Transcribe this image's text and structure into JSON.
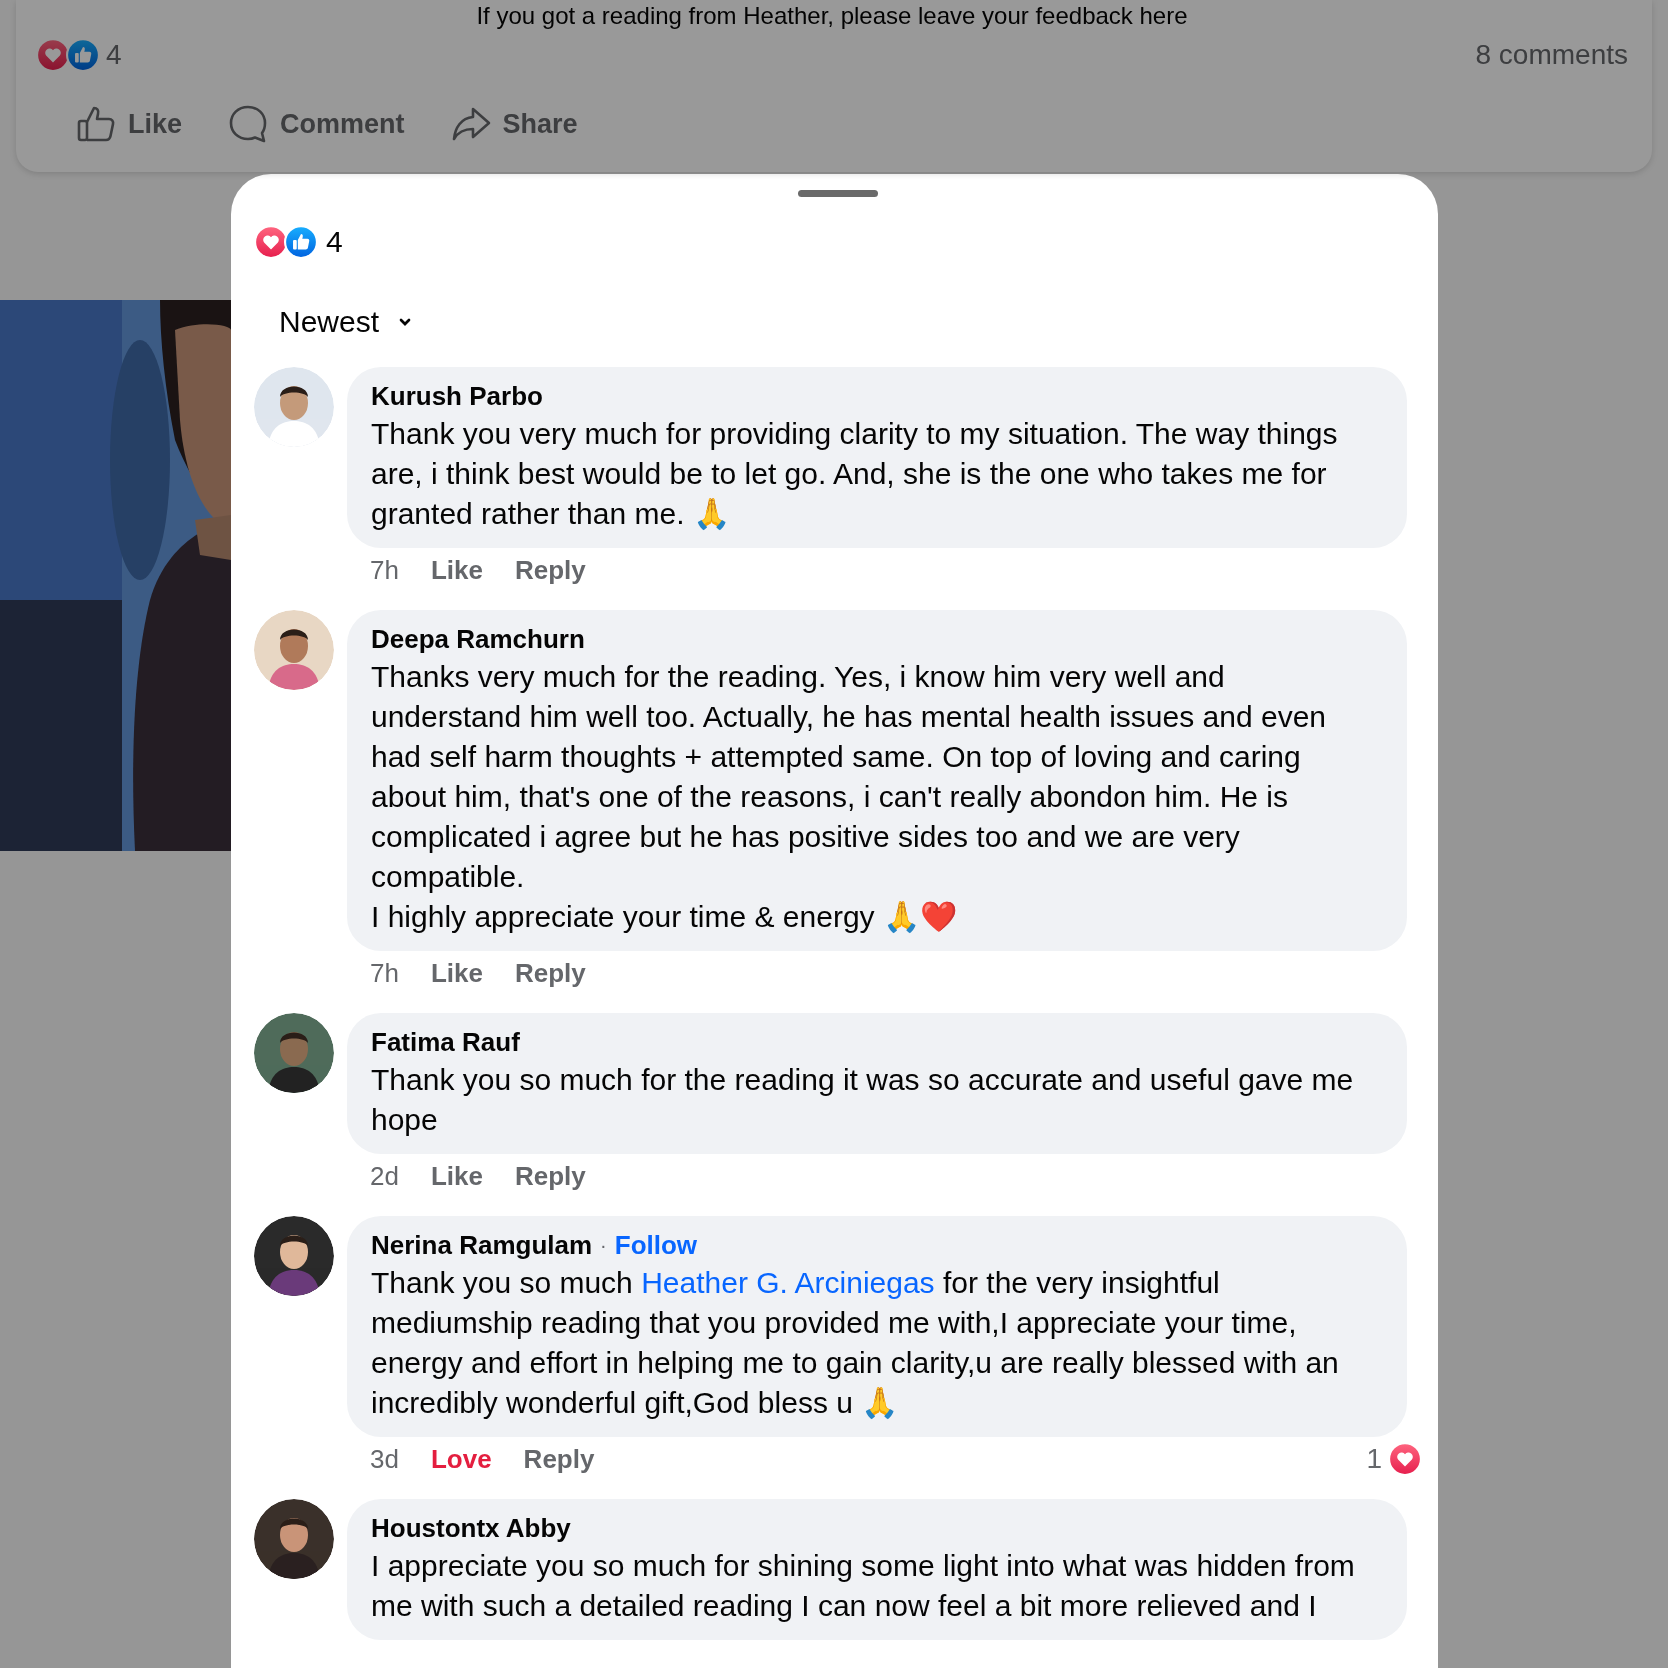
{
  "post": {
    "caption": "If you got a reading from Heather, please leave your feedback here",
    "reaction_count": "4",
    "comment_count": "8 comments",
    "actions": [
      {
        "label": "Like",
        "kind": "like"
      },
      {
        "label": "Comment",
        "kind": "comment"
      },
      {
        "label": "Share",
        "kind": "share"
      }
    ]
  },
  "sheet": {
    "reaction_count": "4",
    "sort": "Newest"
  },
  "comments": [
    {
      "author": "Kurush Parbo",
      "text": [
        {
          "text": "Thank you very much for providing clarity to my situation. The way things are, i think best would be to let go. And, she is the one who takes me for granted rather than me. 🙏"
        }
      ],
      "time": "7h",
      "like_label": "Like",
      "reacted": false,
      "reply_label": "Reply"
    },
    {
      "author": "Deepa Ramchurn",
      "text": [
        {
          "text": "Thanks very much for the reading. Yes, i know him very well and understand him well too. Actually, he has mental health issues and even had self harm thoughts + attempted same. On top of loving and caring about him, that's one of the reasons, i can't really abondon him. He is complicated i agree but he has positive sides too and we are very compatible.\nI highly appreciate your time & energy 🙏❤️"
        }
      ],
      "time": "7h",
      "like_label": "Like",
      "reacted": false,
      "reply_label": "Reply"
    },
    {
      "author": "Fatima Rauf",
      "text": [
        {
          "text": "Thank you so much for the reading it was so accurate and useful gave me hope"
        }
      ],
      "time": "2d",
      "like_label": "Like",
      "reacted": false,
      "reply_label": "Reply"
    },
    {
      "author": "Nerina Ramgulam",
      "separator": "·",
      "follow": "Follow",
      "text": [
        {
          "text": "Thank you so much "
        },
        {
          "text": "Heather G. Arciniegas",
          "kind": "mention"
        },
        {
          "text": " for the very insightful mediumship reading that you provided me with,I appreciate your time, energy and effort in helping me to gain clarity,u are really blessed with an incredibly wonderful gift,God bless u 🙏"
        }
      ],
      "time": "3d",
      "like_label": "Love",
      "reacted": true,
      "reply_label": "Reply",
      "reaction_count": "1"
    },
    {
      "author": "Houstontx Abby",
      "text": [
        {
          "text": "I appreciate you so much for shining some light into what was hidden from me with such a detailed reading I can now feel a bit more relieved and I"
        }
      ]
    }
  ]
}
